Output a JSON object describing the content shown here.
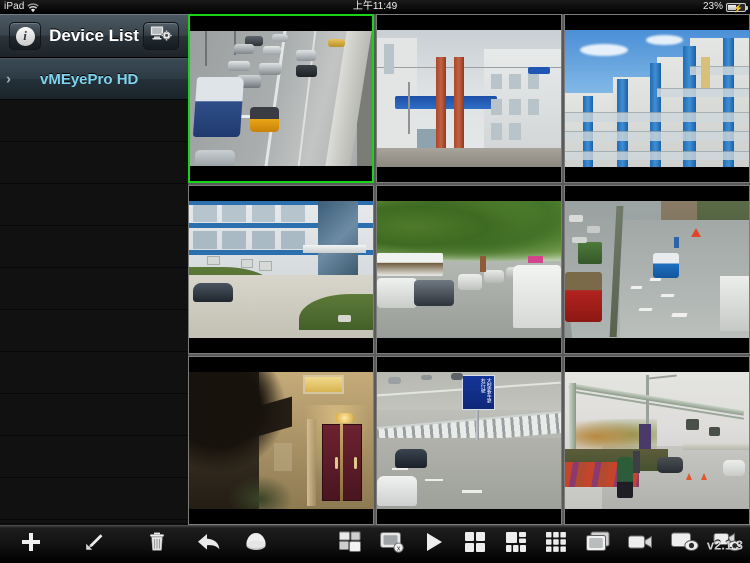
{
  "status_bar": {
    "device_label": "iPad",
    "wifi_icon": "wifi-icon",
    "time": "上午11:49",
    "battery_percent": "23%",
    "battery_icon": "battery-charging-icon"
  },
  "sidebar": {
    "title": "Device List",
    "info_button": {
      "icon": "info-icon",
      "label": "i"
    },
    "config_button": {
      "icon": "monitor-settings-icon"
    },
    "devices": [
      {
        "name": "vMEyePro HD",
        "chevron": "chevron-right-icon",
        "expanded": false
      }
    ]
  },
  "left_toolbar": {
    "buttons": [
      {
        "name": "add-device-button",
        "icon": "plus-icon"
      },
      {
        "name": "edit-device-button",
        "icon": "pencil-icon"
      },
      {
        "name": "delete-device-button",
        "icon": "trash-icon"
      }
    ]
  },
  "main_toolbar": {
    "buttons": [
      {
        "name": "back-button",
        "icon": "back-arrow-icon"
      },
      {
        "name": "ptz-button",
        "icon": "ptz-dome-icon"
      },
      {
        "name": "open-all-windows-button",
        "icon": "windows-open-icon"
      },
      {
        "name": "close-window-button",
        "icon": "window-close-icon"
      },
      {
        "name": "play-button",
        "icon": "play-icon"
      },
      {
        "name": "layout-4-button",
        "icon": "grid-4-icon"
      },
      {
        "name": "layout-6-button",
        "icon": "grid-6-icon"
      },
      {
        "name": "layout-9-button",
        "icon": "grid-9-icon"
      },
      {
        "name": "layout-1-button",
        "icon": "single-window-icon"
      },
      {
        "name": "record-button",
        "icon": "camcorder-icon"
      },
      {
        "name": "snapshot-view-button",
        "icon": "snapshot-eye-icon"
      },
      {
        "name": "playback-view-button",
        "icon": "camcorder-eye-icon"
      }
    ],
    "version": "v2.1.3"
  },
  "video_grid": {
    "columns": 3,
    "rows": 3,
    "selected_index": 0,
    "selection_color": "#17d417",
    "cells": [
      {
        "index": 1,
        "scene": "highway-traffic-with-bus-and-taxi",
        "selected": true
      },
      {
        "index": 2,
        "scene": "white-building-with-orange-pillars",
        "selected": false
      },
      {
        "index": 3,
        "scene": "blue-white-apartment-blocks",
        "selected": false
      },
      {
        "index": 4,
        "scene": "office-building-entrance-with-car",
        "selected": false
      },
      {
        "index": 5,
        "scene": "tree-lined-street-with-traffic",
        "selected": false
      },
      {
        "index": 6,
        "scene": "divided-highway-with-trucks",
        "selected": false
      },
      {
        "index": 7,
        "scene": "night-house-entrance-lit-door",
        "selected": false
      },
      {
        "index": 8,
        "scene": "curved-highway-with-blue-roadsign",
        "selected": false
      },
      {
        "index": 9,
        "scene": "road-gantry-with-cyclist",
        "selected": false
      }
    ],
    "roadsign_text": "大型客车靠右行驶"
  }
}
